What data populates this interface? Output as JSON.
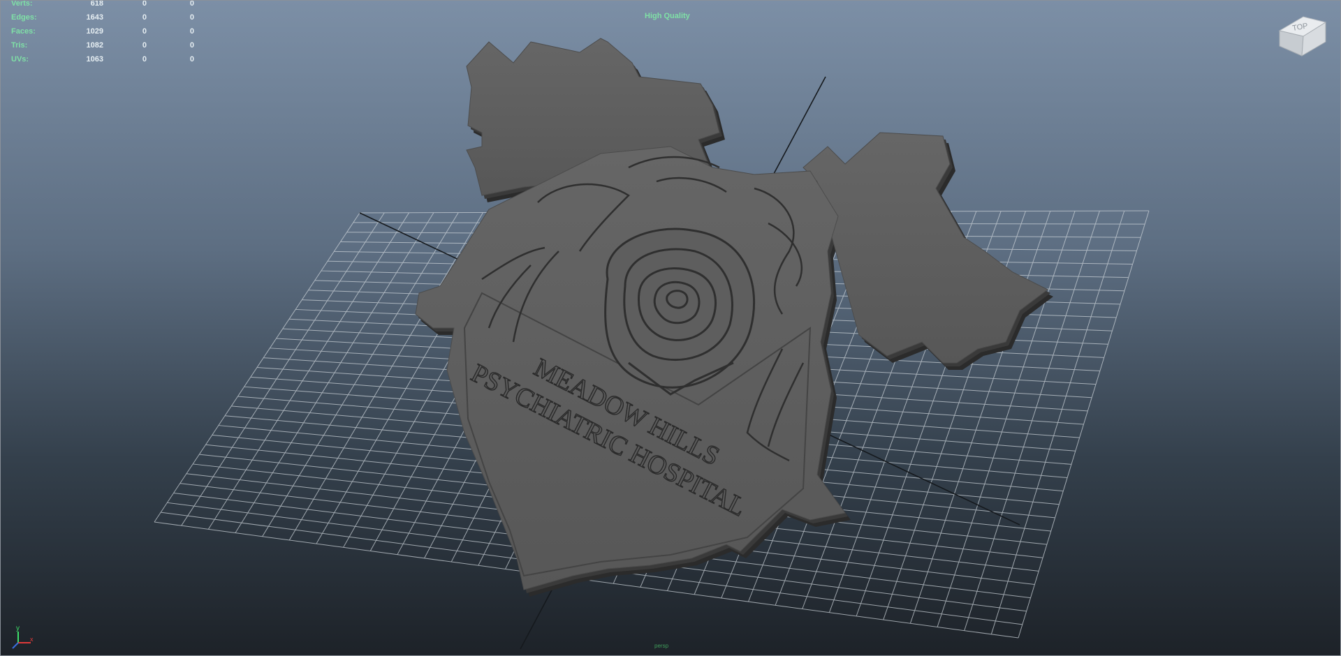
{
  "viewport": {
    "quality_label": "High Quality",
    "camera_label": "persp",
    "viewcube_label": "TOP"
  },
  "hud_stats": [
    {
      "label": "Verts:",
      "v1": "618",
      "v2": "0",
      "v3": "0"
    },
    {
      "label": "Edges:",
      "v1": "1643",
      "v2": "0",
      "v3": "0"
    },
    {
      "label": "Faces:",
      "v1": "1029",
      "v2": "0",
      "v3": "0"
    },
    {
      "label": "Tris:",
      "v1": "1082",
      "v2": "0",
      "v3": "0"
    },
    {
      "label": "UVs:",
      "v1": "1063",
      "v2": "0",
      "v3": "0"
    }
  ],
  "model": {
    "name_line1": "MEADOW HILLS",
    "name_line2": "PSYCHIATRIC HOSPITAL"
  },
  "axis_gizmo": {
    "y": "y",
    "x": "x"
  },
  "colors": {
    "hud_label": "#7fe0a6",
    "model_face": "#5f5f5f",
    "model_side": "#2e2e2e",
    "grid_line": "#c9d0d6"
  },
  "icons": [
    "viewcube-icon",
    "axis-gizmo-icon"
  ]
}
